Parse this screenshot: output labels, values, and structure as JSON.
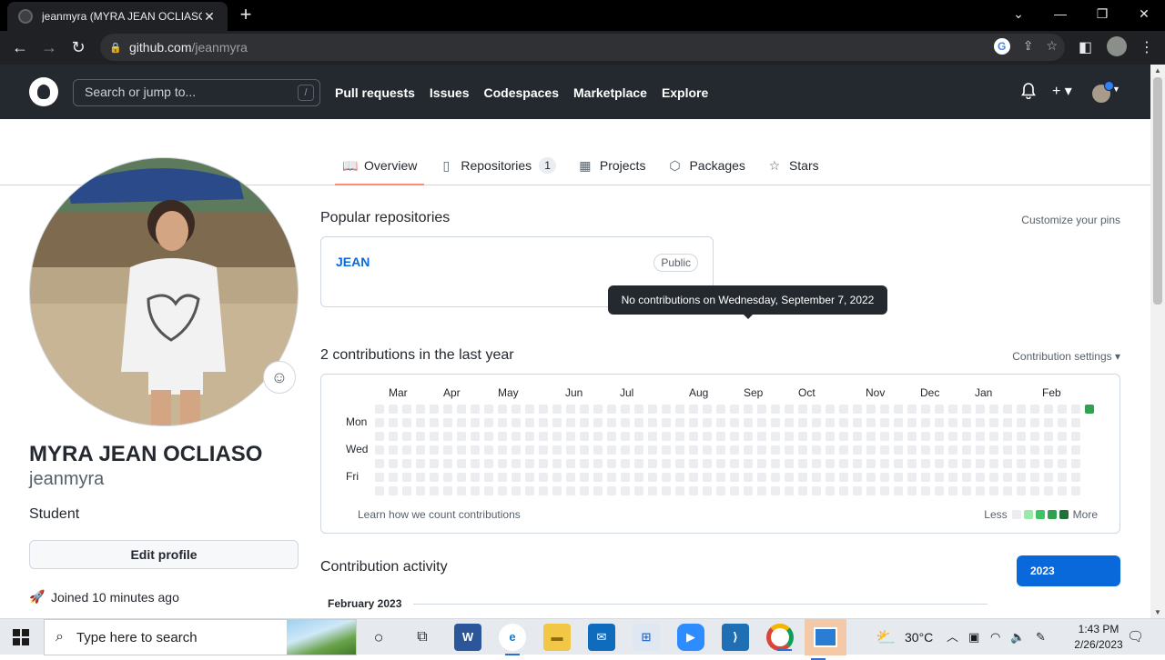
{
  "browser": {
    "tab_title": "jeanmyra (MYRA JEAN OCLIASO)",
    "url_host": "github.com",
    "url_path": "/jeanmyra"
  },
  "gh_header": {
    "search_placeholder": "Search or jump to...",
    "search_shortcut": "/",
    "nav": [
      "Pull requests",
      "Issues",
      "Codespaces",
      "Marketplace",
      "Explore"
    ]
  },
  "profile_tabs": [
    {
      "label": "Overview",
      "icon": "book-icon",
      "active": true
    },
    {
      "label": "Repositories",
      "icon": "repo-icon",
      "counter": "1"
    },
    {
      "label": "Projects",
      "icon": "table-icon"
    },
    {
      "label": "Packages",
      "icon": "package-icon"
    },
    {
      "label": "Stars",
      "icon": "star-icon"
    }
  ],
  "profile": {
    "full_name": "MYRA JEAN OCLIASO",
    "username": "jeanmyra",
    "bio": "Student",
    "edit_label": "Edit profile",
    "joined": "Joined 10 minutes ago"
  },
  "popular": {
    "title": "Popular repositories",
    "customize": "Customize your pins",
    "repo_name": "JEAN",
    "repo_visibility": "Public"
  },
  "contributions": {
    "title": "2 contributions in the last year",
    "settings": "Contribution settings ▾",
    "months": [
      "Mar",
      "Apr",
      "May",
      "Jun",
      "Jul",
      "Aug",
      "Sep",
      "Oct",
      "Nov",
      "Dec",
      "Jan",
      "Feb"
    ],
    "day_labels": [
      "Mon",
      "Wed",
      "Fri"
    ],
    "weeks": 53,
    "active_cells": [
      {
        "week": 52,
        "day": 0,
        "level": 3
      }
    ],
    "tooltip": "No contributions on Wednesday, September 7, 2022",
    "learn": "Learn how we count contributions",
    "legend_less": "Less",
    "legend_more": "More",
    "colors": [
      "#ebedf0",
      "#9be9a8",
      "#40c463",
      "#30a14e",
      "#216e39"
    ]
  },
  "activity": {
    "title": "Contribution activity",
    "year": "2023",
    "month_heading": "February 2023"
  },
  "taskbar": {
    "search_placeholder": "Type here to search",
    "weather": "30°C",
    "time": "1:43 PM",
    "date": "2/26/2023"
  }
}
